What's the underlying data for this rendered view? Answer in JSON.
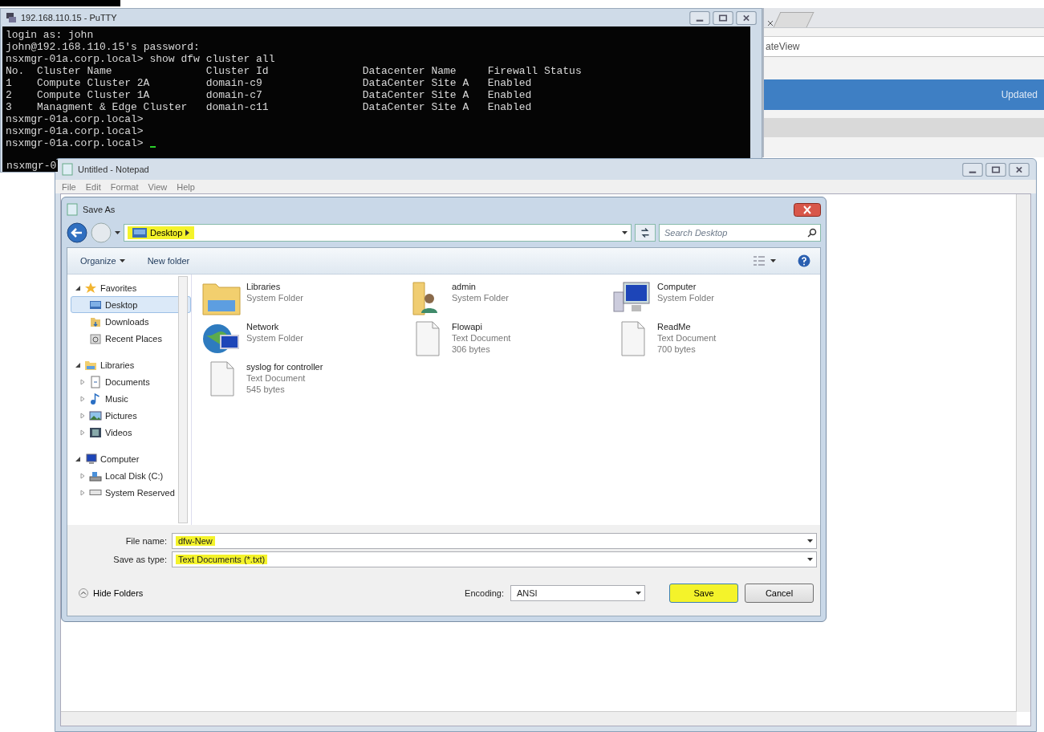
{
  "putty": {
    "title": "192.168.110.15 - PuTTY",
    "lines_before": [
      "login as: john",
      "john@192.168.110.15's password:",
      "nsxmgr-01a.corp.local> show dfw cluster all"
    ],
    "table": {
      "columns": [
        "No.",
        "Cluster Name",
        "Cluster Id",
        "Datacenter Name",
        "Firewall Status"
      ],
      "rows": [
        [
          "1",
          "Compute Cluster 2A",
          "domain-c9",
          "DataCenter Site A",
          "Enabled"
        ],
        [
          "2",
          "Compute Cluster 1A",
          "domain-c7",
          "DataCenter Site A",
          "Enabled"
        ],
        [
          "3",
          "Managment & Edge Cluster",
          "domain-c11",
          "DataCenter Site A",
          "Enabled"
        ]
      ]
    },
    "lines_after": [
      "nsxmgr-01a.corp.local>",
      "nsxmgr-01a.corp.local>",
      "nsxmgr-01a.corp.local>"
    ],
    "cut_line": "nsxmgr-0"
  },
  "browser": {
    "address": "ateView",
    "banner": "Updated"
  },
  "notepad": {
    "title": "Untitled - Notepad",
    "menu": [
      "File",
      "Edit",
      "Format",
      "View",
      "Help"
    ]
  },
  "save_as": {
    "title": "Save As",
    "breadcrumb": {
      "label": "Desktop",
      "highlighted": true
    },
    "search": {
      "placeholder": "Search Desktop"
    },
    "toolbar": [
      {
        "label": "Organize",
        "kind": "menu"
      },
      {
        "label": "New folder",
        "kind": "button"
      }
    ],
    "nav": [
      {
        "label": "Favorites",
        "kind": "favorites",
        "expanded": true,
        "selected": false,
        "children": [
          {
            "label": "Desktop",
            "kind": "desktop",
            "selected": true
          },
          {
            "label": "Downloads",
            "kind": "downloads",
            "selected": false
          },
          {
            "label": "Recent Places",
            "kind": "recent",
            "selected": false
          }
        ]
      },
      {
        "label": "Libraries",
        "kind": "libraries",
        "expanded": true,
        "selected": false,
        "children": [
          {
            "label": "Documents",
            "kind": "documents",
            "expanded": false,
            "selected": false
          },
          {
            "label": "Music",
            "kind": "music",
            "expanded": false,
            "selected": false
          },
          {
            "label": "Pictures",
            "kind": "pictures",
            "expanded": false,
            "selected": false
          },
          {
            "label": "Videos",
            "kind": "videos",
            "expanded": false,
            "selected": false
          }
        ]
      },
      {
        "label": "Computer",
        "kind": "computer",
        "expanded": true,
        "selected": false,
        "children": [
          {
            "label": "Local Disk (C:)",
            "kind": "disk",
            "expanded": false,
            "selected": false
          },
          {
            "label": "System Reserved",
            "kind": "drive",
            "expanded": false,
            "selected": false
          }
        ]
      }
    ],
    "files": [
      {
        "name": "Libraries",
        "type": "System Folder",
        "kind": "libraries"
      },
      {
        "name": "admin",
        "type": "System Folder",
        "kind": "user"
      },
      {
        "name": "Computer",
        "type": "System Folder",
        "kind": "computer"
      },
      {
        "name": "Network",
        "type": "System Folder",
        "kind": "network"
      },
      {
        "name": "Flowapi",
        "type": "Text Document",
        "size": "306 bytes",
        "kind": "text"
      },
      {
        "name": "ReadMe",
        "type": "Text Document",
        "size": "700 bytes",
        "kind": "text"
      },
      {
        "name": "syslog for controller",
        "type": "Text Document",
        "size": "545 bytes",
        "kind": "text"
      }
    ],
    "file_name": {
      "label": "File name:",
      "value": "dfw-New",
      "highlighted": true
    },
    "save_type": {
      "label": "Save as type:",
      "value": "Text Documents (*.txt)",
      "highlighted": true
    },
    "hide_folders": "Hide Folders",
    "encoding": {
      "label": "Encoding:",
      "value": "ANSI"
    },
    "buttons": [
      {
        "label": "Save",
        "highlighted": true
      },
      {
        "label": "Cancel",
        "highlighted": false
      }
    ]
  }
}
